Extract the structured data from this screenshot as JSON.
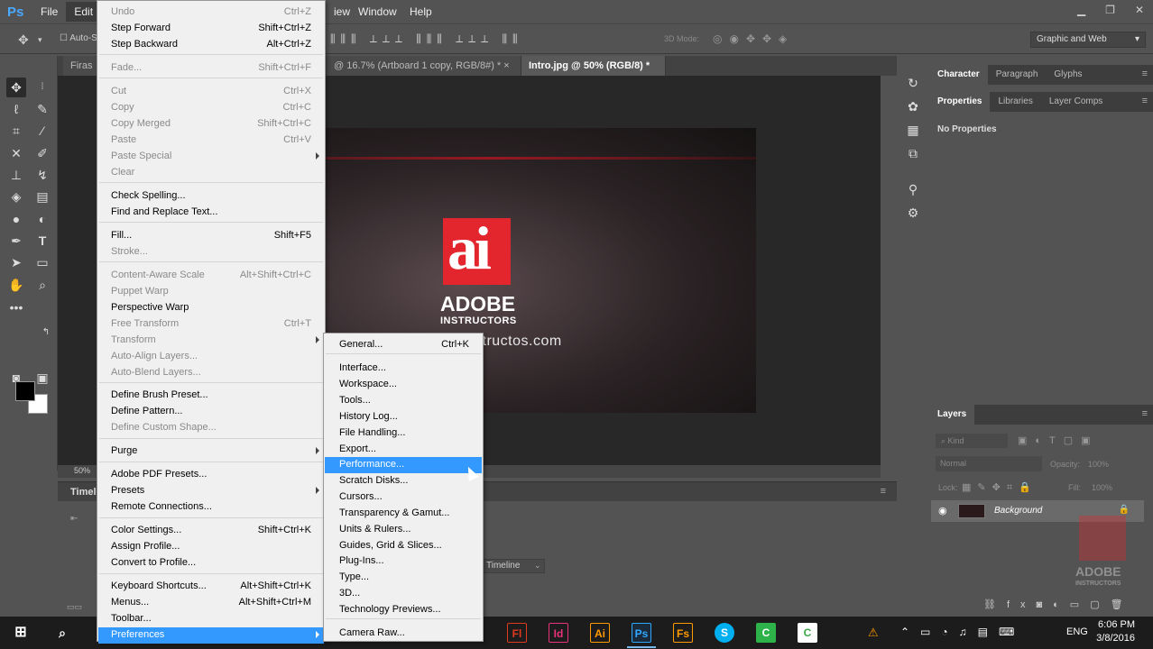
{
  "app": {
    "logo": "Ps"
  },
  "menubar": {
    "items": [
      "File",
      "Edit"
    ],
    "right_items": [
      "iew",
      "Window",
      "Help"
    ]
  },
  "options": {
    "auto_select": "Auto-S",
    "mode_3d": "3D Mode:",
    "workspace": "Graphic and Web"
  },
  "doc_tabs": [
    {
      "label": "Firas"
    },
    {
      "label": "@ 16.7% (Artboard 1  copy, RGB/8#) *",
      "close": "×"
    },
    {
      "label": "Intro.jpg @ 50% (RGB/8) *",
      "close": "×"
    }
  ],
  "artwork": {
    "logo_mark": "ai",
    "title": "ADOBE",
    "subtitle": "INSTRUCTORS",
    "url": "structos.com"
  },
  "status": {
    "zoom": "50%"
  },
  "timeline": {
    "label": "Timeli",
    "select": "Timeline"
  },
  "panels": {
    "top_tabs": [
      "Character",
      "Paragraph",
      "Glyphs"
    ],
    "props_tabs": [
      "Properties",
      "Libraries",
      "Layer Comps"
    ],
    "no_properties": "No Properties",
    "layers_title": "Layers",
    "kind": "Kind",
    "blend_mode": "Normal",
    "opacity_label": "Opacity:",
    "opacity_value": "100%",
    "lock_label": "Lock:",
    "fill_label": "Fill:",
    "fill_value": "100%",
    "layer_name": "Background",
    "watermark_title": "ADOBE",
    "watermark_sub": "INSTRUCTORS"
  },
  "edit_menu": [
    {
      "label": "Undo",
      "shortcut": "Ctrl+Z",
      "disabled": true
    },
    {
      "label": "Step Forward",
      "shortcut": "Shift+Ctrl+Z",
      "disabled": false
    },
    {
      "label": "Step Backward",
      "shortcut": "Alt+Ctrl+Z",
      "disabled": false
    },
    {
      "label": "Fade...",
      "shortcut": "Shift+Ctrl+F",
      "disabled": true
    },
    {
      "label": "Cut",
      "shortcut": "Ctrl+X",
      "disabled": true
    },
    {
      "label": "Copy",
      "shortcut": "Ctrl+C",
      "disabled": true
    },
    {
      "label": "Copy Merged",
      "shortcut": "Shift+Ctrl+C",
      "disabled": true
    },
    {
      "label": "Paste",
      "shortcut": "Ctrl+V",
      "disabled": true
    },
    {
      "label": "Paste Special",
      "shortcut": "",
      "disabled": true,
      "submenu": true
    },
    {
      "label": "Clear",
      "shortcut": "",
      "disabled": true
    },
    {
      "label": "Check Spelling...",
      "shortcut": "",
      "disabled": false
    },
    {
      "label": "Find and Replace Text...",
      "shortcut": "",
      "disabled": false
    },
    {
      "label": "Fill...",
      "shortcut": "Shift+F5",
      "disabled": false
    },
    {
      "label": "Stroke...",
      "shortcut": "",
      "disabled": true
    },
    {
      "label": "Content-Aware Scale",
      "shortcut": "Alt+Shift+Ctrl+C",
      "disabled": true
    },
    {
      "label": "Puppet Warp",
      "shortcut": "",
      "disabled": true
    },
    {
      "label": "Perspective Warp",
      "shortcut": "",
      "disabled": false
    },
    {
      "label": "Free Transform",
      "shortcut": "Ctrl+T",
      "disabled": true
    },
    {
      "label": "Transform",
      "shortcut": "",
      "disabled": true,
      "submenu": true
    },
    {
      "label": "Auto-Align Layers...",
      "shortcut": "",
      "disabled": true
    },
    {
      "label": "Auto-Blend Layers...",
      "shortcut": "",
      "disabled": true
    },
    {
      "label": "Define Brush Preset...",
      "shortcut": "",
      "disabled": false
    },
    {
      "label": "Define Pattern...",
      "shortcut": "",
      "disabled": false
    },
    {
      "label": "Define Custom Shape...",
      "shortcut": "",
      "disabled": true
    },
    {
      "label": "Purge",
      "shortcut": "",
      "disabled": false,
      "submenu": true
    },
    {
      "label": "Adobe PDF Presets...",
      "shortcut": "",
      "disabled": false
    },
    {
      "label": "Presets",
      "shortcut": "",
      "disabled": false,
      "submenu": true
    },
    {
      "label": "Remote Connections...",
      "shortcut": "",
      "disabled": false
    },
    {
      "label": "Color Settings...",
      "shortcut": "Shift+Ctrl+K",
      "disabled": false
    },
    {
      "label": "Assign Profile...",
      "shortcut": "",
      "disabled": false
    },
    {
      "label": "Convert to Profile...",
      "shortcut": "",
      "disabled": false
    },
    {
      "label": "Keyboard Shortcuts...",
      "shortcut": "Alt+Shift+Ctrl+K",
      "disabled": false
    },
    {
      "label": "Menus...",
      "shortcut": "Alt+Shift+Ctrl+M",
      "disabled": false
    },
    {
      "label": "Toolbar...",
      "shortcut": "",
      "disabled": false
    },
    {
      "label": "Preferences",
      "shortcut": "",
      "disabled": false,
      "submenu": true,
      "highlighted": true
    }
  ],
  "preferences_menu": [
    {
      "label": "General...",
      "shortcut": "Ctrl+K"
    },
    {
      "label": "Interface...",
      "shortcut": ""
    },
    {
      "label": "Workspace...",
      "shortcut": ""
    },
    {
      "label": "Tools...",
      "shortcut": ""
    },
    {
      "label": "History Log...",
      "shortcut": ""
    },
    {
      "label": "File Handling...",
      "shortcut": ""
    },
    {
      "label": "Export...",
      "shortcut": ""
    },
    {
      "label": "Performance...",
      "shortcut": "",
      "highlighted": true
    },
    {
      "label": "Scratch Disks...",
      "shortcut": ""
    },
    {
      "label": "Cursors...",
      "shortcut": ""
    },
    {
      "label": "Transparency & Gamut...",
      "shortcut": ""
    },
    {
      "label": "Units & Rulers...",
      "shortcut": ""
    },
    {
      "label": "Guides, Grid & Slices...",
      "shortcut": ""
    },
    {
      "label": "Plug-Ins...",
      "shortcut": ""
    },
    {
      "label": "Type...",
      "shortcut": ""
    },
    {
      "label": "3D...",
      "shortcut": ""
    },
    {
      "label": "Technology Previews...",
      "shortcut": ""
    },
    {
      "label": "Camera Raw...",
      "shortcut": ""
    }
  ],
  "taskbar": {
    "apps": [
      {
        "name": "flash",
        "label": "Fl",
        "color": "#e03a1e"
      },
      {
        "name": "indesign",
        "label": "Id",
        "color": "#e8327a"
      },
      {
        "name": "illustrator",
        "label": "Ai",
        "color": "#ff9a00"
      },
      {
        "name": "photoshop",
        "label": "Ps",
        "color": "#31a8ff"
      },
      {
        "name": "fireworks",
        "label": "Fs",
        "color": "#ff9a00"
      },
      {
        "name": "skype",
        "label": "S",
        "color": "#00aff0"
      },
      {
        "name": "camtasia",
        "label": "C",
        "color": "#2db34a"
      },
      {
        "name": "camtasia-recorder",
        "label": "C",
        "color": "#3aa84a"
      }
    ],
    "language": "ENG",
    "time": "6:06 PM",
    "date": "3/8/2016"
  },
  "colors": {
    "highlight": "#3399ff",
    "brand_red": "#e3262e",
    "menu_bg": "#f0f0f0",
    "ui_bg": "#535353"
  }
}
